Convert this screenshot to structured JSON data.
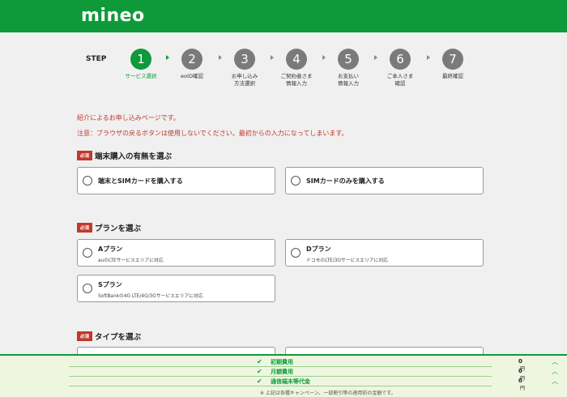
{
  "header": {
    "logo": "mineo"
  },
  "steps": {
    "title": "STEP",
    "items": [
      {
        "number": "1",
        "label": "サービス選択"
      },
      {
        "number": "2",
        "label": "eoID確認"
      },
      {
        "number": "3",
        "label": "お申し込み\n方法選択"
      },
      {
        "number": "4",
        "label": "ご契約者さま\n情報入力"
      },
      {
        "number": "5",
        "label": "お支払い\n情報入力"
      },
      {
        "number": "6",
        "label": "ご本人さま\n確認"
      },
      {
        "number": "7",
        "label": "最終確認"
      }
    ]
  },
  "notices": {
    "referral": "紹介によるお申し込みページです。",
    "warning": "注意：ブラウザの戻るボタンは使用しないでください。最初からの入力になってしまいます。"
  },
  "required_label": "必須",
  "sections": {
    "device": {
      "title": "端末購入の有無を選ぶ",
      "options": [
        {
          "label": "端末とSIMカードを購入する"
        },
        {
          "label": "SIMカードのみを購入する"
        }
      ]
    },
    "plan": {
      "title": "プランを選ぶ",
      "options": [
        {
          "label": "Aプラン",
          "sub": "auのLTEサービスエリアに対応"
        },
        {
          "label": "Dプラン",
          "sub": "ドコモのLTE/3Gサービスエリアに対応"
        },
        {
          "label": "Sプラン",
          "sub": "SoftBankの4G LTE/4G/3Gサービスエリアに対応"
        }
      ]
    },
    "type": {
      "title": "タイプを選ぶ"
    }
  },
  "fees": {
    "rows": [
      {
        "label": "初期費用",
        "amount": "0",
        "unit": "円"
      },
      {
        "label": "月額費用",
        "amount": "0",
        "unit": "円"
      },
      {
        "label": "通信端末等代金",
        "amount": "0",
        "unit": "円"
      }
    ],
    "note": "※ 上記は各種キャンペーン、一部割引等の適用前の金額です。"
  },
  "colors": {
    "brand": "#0e9a3a",
    "required": "#c0392b",
    "step_inactive": "#7a7a7a"
  }
}
